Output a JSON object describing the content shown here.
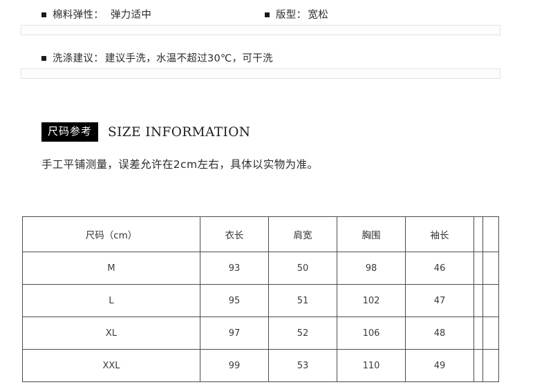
{
  "specs": {
    "row1": [
      {
        "label": "棉料弹性：",
        "value": "弹力适中",
        "bullet": "square-bullet"
      },
      {
        "label": "版型：",
        "value": "宽松",
        "bullet": "square-bullet"
      }
    ],
    "row2": [
      {
        "label": "洗涤建议：",
        "value": "建议手洗，水温不超过30℃，可干洗",
        "bullet": "square-bullet"
      }
    ]
  },
  "section": {
    "badge": "尺码参考",
    "english_title": "SIZE INFORMATION",
    "note": "手工平铺测量，误差允许在2cm左右，具体以实物为准。"
  },
  "size_table": {
    "headers": [
      "尺码（cm）",
      "衣长",
      "肩宽",
      "胸围",
      "袖长",
      "",
      ""
    ],
    "rows": [
      {
        "size": "M",
        "length": "93",
        "shoulder": "50",
        "bust": "98",
        "sleeve": "46",
        "extra1": "",
        "extra2": ""
      },
      {
        "size": "L",
        "length": "95",
        "shoulder": "51",
        "bust": "102",
        "sleeve": "47",
        "extra1": "",
        "extra2": ""
      },
      {
        "size": "XL",
        "length": "97",
        "shoulder": "52",
        "bust": "106",
        "sleeve": "48",
        "extra1": "",
        "extra2": ""
      },
      {
        "size": "XXL",
        "length": "99",
        "shoulder": "53",
        "bust": "110",
        "sleeve": "49",
        "extra1": "",
        "extra2": ""
      }
    ]
  },
  "colors": {
    "badge_background": "#000000",
    "badge_text": "#ffffff",
    "table_border": "#4a4a4a",
    "divider_border": "#e2e2e2",
    "body_text": "#2b2b2b",
    "page_background": "#ffffff"
  }
}
